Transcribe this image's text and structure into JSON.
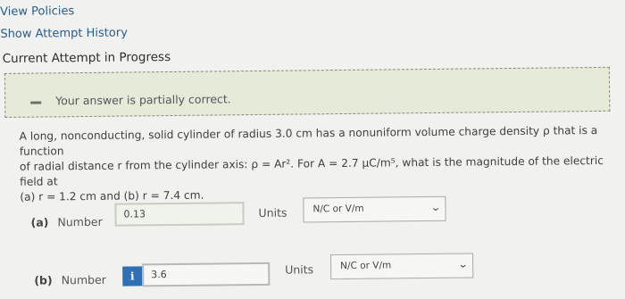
{
  "links": {
    "view_policies": "View Policies",
    "show_attempt_history": "Show Attempt History"
  },
  "current_attempt": "Current Attempt in Progress",
  "feedback": {
    "message": "Your answer is partially correct."
  },
  "question": {
    "text_line1": "A long, nonconducting, solid cylinder of radius 3.0 cm has a nonuniform volume charge density ρ that is a function",
    "text_line2": "of radial distance r from the cylinder axis: ρ = Ar². For A = 2.7 μC/m⁵, what is the magnitude of the electric field at",
    "text_line3": "(a) r = 1.2 cm and (b) r = 7.4 cm."
  },
  "parts": [
    {
      "tag": "(a)",
      "label": "Number",
      "value": "0.13",
      "units_label": "Units",
      "unit_selected": "N/C or V/m"
    },
    {
      "tag": "(b)",
      "label": "Number",
      "value": "3.6",
      "info_icon": "i",
      "units_label": "Units",
      "unit_selected": "N/C or V/m"
    }
  ],
  "colors": {
    "background": "#f1f1ef",
    "link": "#2b5d8c",
    "feedback_bg": "#e6ead9",
    "info_button": "#2f6fb4"
  }
}
